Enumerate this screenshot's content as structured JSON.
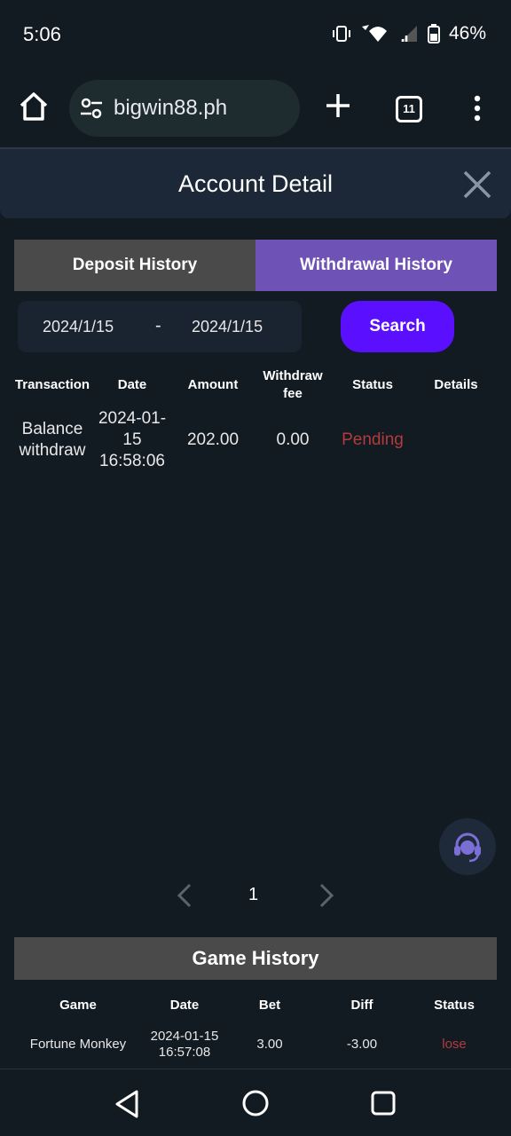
{
  "status_bar": {
    "time": "5:06",
    "battery": "46%"
  },
  "browser": {
    "url": "bigwin88.ph",
    "tab_count": "11"
  },
  "modal": {
    "title": "Account Detail"
  },
  "tabs": [
    {
      "label": "Deposit History",
      "active": false
    },
    {
      "label": "Withdrawal History",
      "active": true
    }
  ],
  "filter": {
    "start_date": "2024/1/15",
    "separator": "-",
    "end_date": "2024/1/15",
    "search_label": "Search"
  },
  "withdrawal_table": {
    "headers": [
      "Transaction",
      "Date",
      "Amount",
      "Withdraw fee",
      "Status",
      "Details"
    ],
    "rows": [
      {
        "transaction": "Balance withdraw",
        "date": "2024-01-15 16:58:06",
        "amount": "202.00",
        "withdraw_fee": "0.00",
        "status": "Pending",
        "details": ""
      }
    ]
  },
  "pagination": {
    "current_page": "1"
  },
  "game_history": {
    "title": "Game History",
    "headers": [
      "Game",
      "Date",
      "Bet",
      "Diff",
      "Status"
    ],
    "rows": [
      {
        "game": "Fortune Monkey",
        "date": "2024-01-15 16:57:08",
        "bet": "3.00",
        "diff": "-3.00",
        "status": "lose"
      }
    ]
  },
  "colors": {
    "background": "#121a22",
    "active_tab": "#6f52b5",
    "search_button": "#5a10ff",
    "status_negative": "#b53b3b"
  }
}
